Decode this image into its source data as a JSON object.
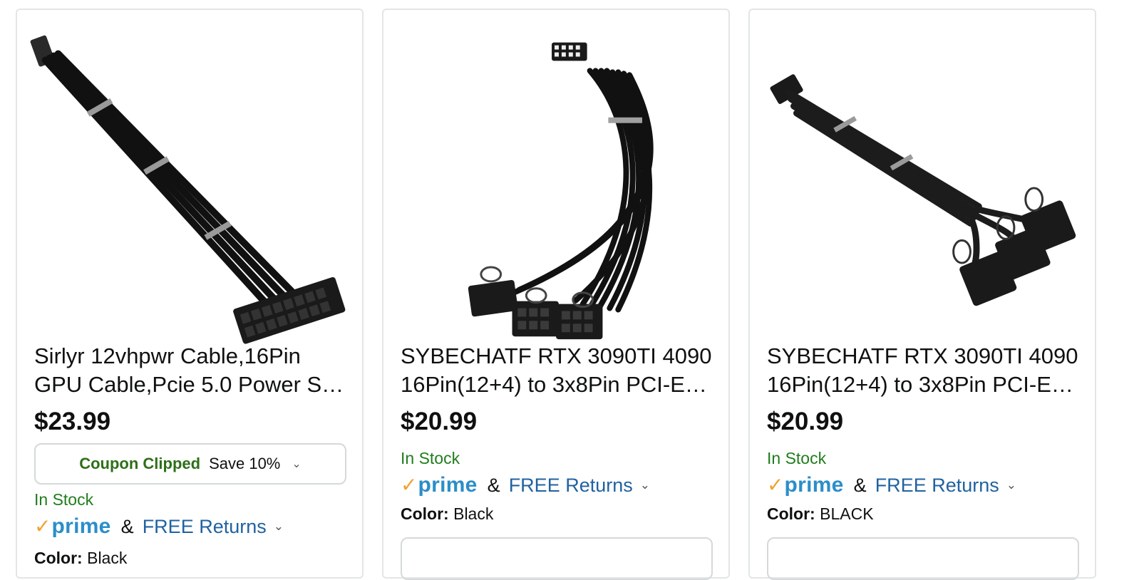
{
  "products": [
    {
      "title": "Sirlyr 12vhpwr Cable,16Pin GPU Cable,Pcie 5.0 Power S…",
      "price": "$23.99",
      "coupon": {
        "status": "Coupon Clipped",
        "save": "Save 10%"
      },
      "stock": "In Stock",
      "prime": "prime",
      "amp": "&",
      "returns": "FREE Returns",
      "color_label": "Color:",
      "color_value": "Black"
    },
    {
      "title": "SYBECHATF RTX 3090TI 4090 16Pin(12+4) to 3x8Pin PCI-E…",
      "price": "$20.99",
      "stock": "In Stock",
      "prime": "prime",
      "amp": "&",
      "returns": "FREE Returns",
      "color_label": "Color:",
      "color_value": "Black"
    },
    {
      "title": "SYBECHATF RTX 3090TI 4090 16Pin(12+4) to 3x8Pin PCI-E…",
      "price": "$20.99",
      "stock": "In Stock",
      "prime": "prime",
      "amp": "&",
      "returns": "FREE Returns",
      "color_label": "Color:",
      "color_value": "BLACK"
    }
  ],
  "colors": {
    "stock_green": "#207d1c",
    "coupon_green": "#2d6f17",
    "link_blue": "#2162a1",
    "prime_blue": "#2b8ec9",
    "prime_check": "#f2a22e"
  },
  "icons": [
    "chevron-down-icon",
    "prime-check-icon"
  ]
}
